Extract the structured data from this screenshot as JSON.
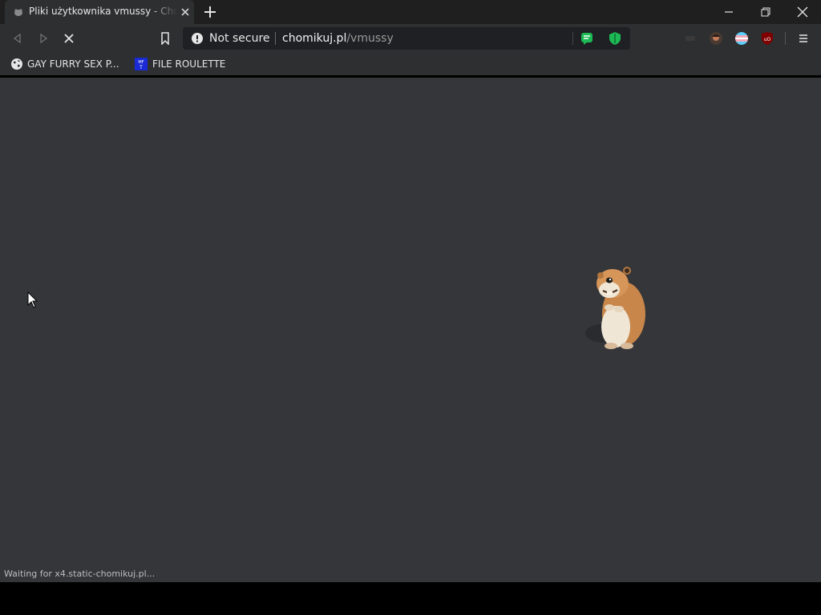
{
  "tab": {
    "title": "Pliki użytkownika vmussy - Chomikuj.pl",
    "favicon": "hamster-favicon-icon",
    "close": "close-tab-icon"
  },
  "window_controls": [
    "minimize-icon",
    "restore-icon",
    "close-window-icon"
  ],
  "toolbar": {
    "back": "back-arrow-icon",
    "forward": "forward-arrow-icon",
    "stop": "stop-loading-icon",
    "bookmark": "bookmark-icon"
  },
  "omnibox": {
    "security_label": "Not secure",
    "url_host": "chomikuj.pl",
    "url_path": "/vmussy"
  },
  "extensions": [
    "chat-extension-icon",
    "shield-extension-icon",
    "hidden-extension-icon",
    "avatar-extension-icon",
    "flag-extension-icon",
    "ublock-icon"
  ],
  "bookmarks": [
    {
      "label": "GAY FURRY SEX P...",
      "icon": "globe-icon"
    },
    {
      "label": "FILE ROULETTE",
      "icon": "mft-icon"
    }
  ],
  "page": {
    "mascot": "hamster-mascot"
  },
  "status_bar": {
    "text": "Waiting for x4.static-chomikuj.pl..."
  },
  "colors": {
    "content_bg": "#35363a",
    "frame_bg": "#1f1f1f",
    "toolbar_bg": "#2e2f31",
    "accent_green": "#1db954"
  }
}
